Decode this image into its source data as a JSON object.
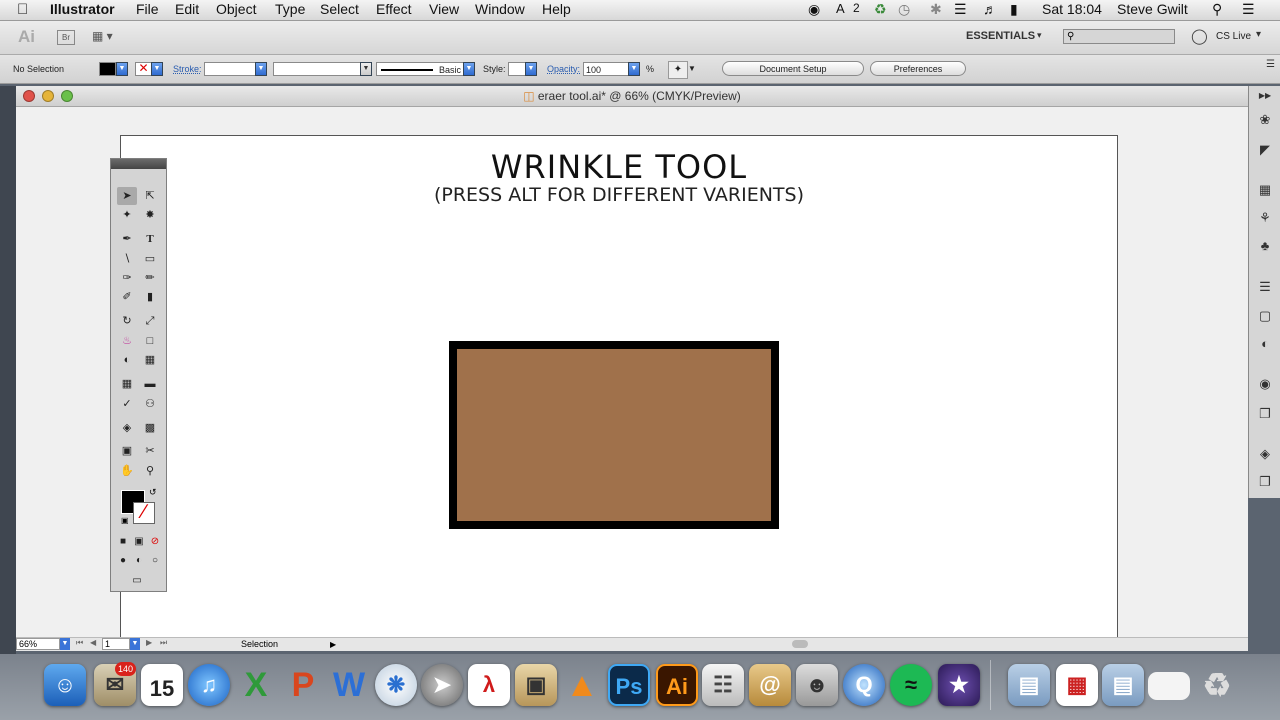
{
  "menubar": {
    "app_name": "Illustrator",
    "items": [
      "File",
      "Edit",
      "Object",
      "Type",
      "Select",
      "Effect",
      "View",
      "Window",
      "Help"
    ],
    "status_badge": "2",
    "clock": "Sat 18:04",
    "user": "Steve Gwilt"
  },
  "appbar": {
    "ai_logo": "Ai",
    "br_label": "Br",
    "workspace": "ESSENTIALS",
    "cs_live": "CS Live"
  },
  "control": {
    "selection": "No Selection",
    "stroke_label": "Stroke:",
    "brush_label": "Basic",
    "style_label": "Style:",
    "opacity_label": "Opacity:",
    "opacity_value": "100",
    "percent": "%",
    "document_setup": "Document Setup",
    "preferences": "Preferences"
  },
  "document": {
    "title": "eraer tool.ai* @ 66% (CMYK/Preview)",
    "heading": "WRINKLE TOOL",
    "subheading": "(PRESS ALT FOR DIFFERENT VARIENTS)",
    "rect_fill": "#a0714b",
    "rect_stroke": "#000000"
  },
  "statusbar": {
    "zoom": "66%",
    "page": "1",
    "tool": "Selection"
  },
  "dock": {
    "calendar_day": "15",
    "mail_badge": "140",
    "apps": [
      "Finder",
      "Mail",
      "Calendar",
      "iTunes",
      "Excel",
      "PowerPoint",
      "Word",
      "Safari",
      "Rocket",
      "Acrobat",
      "Preview",
      "VLC",
      "Photoshop",
      "Illustrator",
      "Dictionary",
      "Contacts",
      "Photo Booth",
      "QuickTime",
      "Spotify",
      "iMovie"
    ]
  }
}
